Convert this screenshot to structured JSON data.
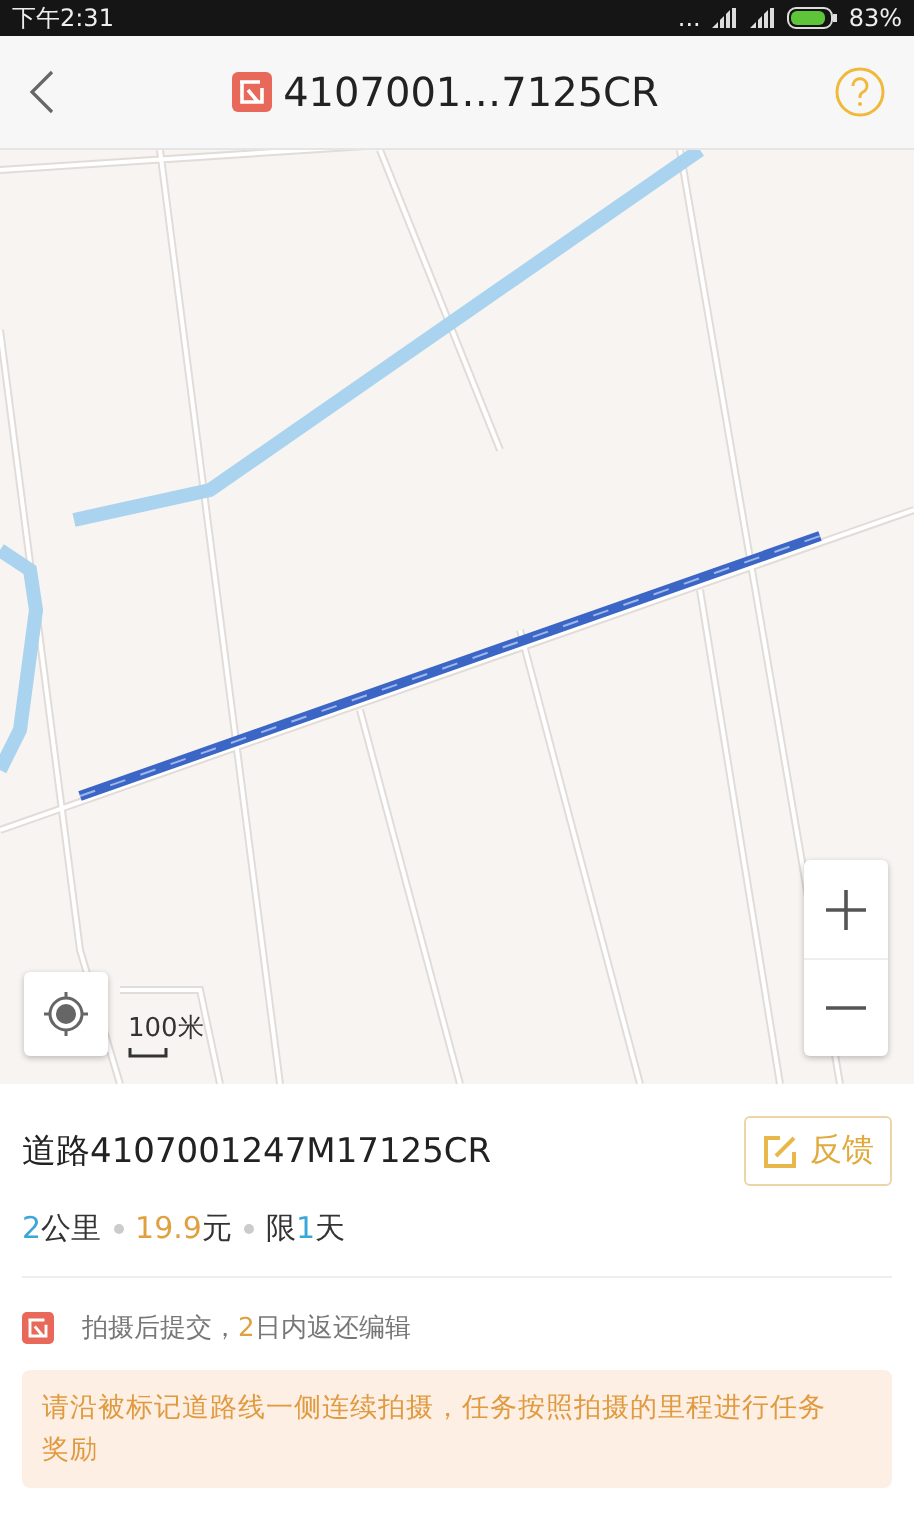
{
  "status_bar": {
    "time": "下午2:31",
    "dots": "...",
    "battery": "83%"
  },
  "header": {
    "title": "4107001…7125CR"
  },
  "map": {
    "kind": "picture",
    "scale": "100米"
  },
  "task": {
    "title": "道路4107001247M17125CR",
    "feedback_button": "反馈",
    "stats": [
      {
        "value": "2",
        "unit": "公里",
        "color": "#3aa7d8"
      },
      {
        "value": "19.9",
        "unit": "元",
        "color": "#e0a040"
      },
      {
        "prefix": "限",
        "value": "1",
        "unit": "天",
        "color": "#3aa7d8"
      }
    ],
    "notice": {
      "before": "拍摄后提交，",
      "highlight": "2",
      "after": "日内返还编辑"
    },
    "tip": "请沿被标记道路线一侧连续拍摄，任务按照拍摄的里程进行任务奖励"
  }
}
